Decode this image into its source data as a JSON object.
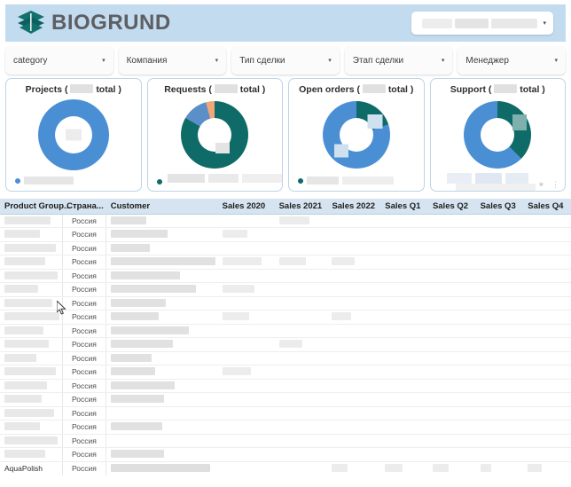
{
  "header": {
    "brand": "BIOGRUND",
    "logo_icon": "hexagon-leaf-logo",
    "band_color": "#c3dbef",
    "brand_text_color": "#5d5f63",
    "logo_color": "#10706c",
    "selector": {
      "name": "header-selector",
      "value": "",
      "caret": "▾"
    }
  },
  "filters": [
    {
      "label": "category",
      "caret": "▾"
    },
    {
      "label": "Компания",
      "caret": "▾"
    },
    {
      "label": "Тип сделки",
      "caret": "▾"
    },
    {
      "label": "Этап сделки",
      "caret": "▾"
    },
    {
      "label": "Менеджер",
      "caret": "▾"
    }
  ],
  "cards": [
    {
      "title_prefix": "Projects (",
      "title_suffix": "total )",
      "donut_colors": [
        "#4a8fd4"
      ],
      "legend_dot": "#4a8fd4"
    },
    {
      "title_prefix": "Requests (",
      "title_suffix": "total )",
      "donut_colors": [
        "#0f6b68",
        "#5a8fc8",
        "#f0a878"
      ],
      "legend_dot": "#0f6b68"
    },
    {
      "title_prefix": "Open orders (",
      "title_suffix": "total )",
      "donut_colors": [
        "#4a8fd4",
        "#0f6b68"
      ],
      "legend_dot": "#0f6b68"
    },
    {
      "title_prefix": "Support (",
      "title_suffix": "total )",
      "donut_colors": [
        "#4a8fd4",
        "#0f6b68"
      ],
      "legend_dot": "#4a8fd4"
    }
  ],
  "card_icons": {
    "pin": "✶",
    "menu": "⋮"
  },
  "table": {
    "columns": [
      "Product Group...",
      "Страна...",
      "Customer",
      "Sales 2020",
      "Sales 2021",
      "Sales 2022",
      "Sales Q1",
      "Sales Q2",
      "Sales Q3",
      "Sales Q4"
    ],
    "country_value": "Россия",
    "rows": [
      {
        "product": "",
        "country": "Россия",
        "customer": ""
      },
      {
        "product": "",
        "country": "Россия",
        "customer": ""
      },
      {
        "product": "",
        "country": "Россия",
        "customer": ""
      },
      {
        "product": "",
        "country": "Россия",
        "customer": ""
      },
      {
        "product": "",
        "country": "Россия",
        "customer": ""
      },
      {
        "product": "",
        "country": "Россия",
        "customer": ""
      },
      {
        "product": "",
        "country": "Россия",
        "customer": ""
      },
      {
        "product": "",
        "country": "Россия",
        "customer": ""
      },
      {
        "product": "",
        "country": "Россия",
        "customer": ""
      },
      {
        "product": "",
        "country": "Россия",
        "customer": ""
      },
      {
        "product": "",
        "country": "Россия",
        "customer": ""
      },
      {
        "product": "",
        "country": "Россия",
        "customer": ""
      },
      {
        "product": "",
        "country": "Россия",
        "customer": ""
      },
      {
        "product": "",
        "country": "Россия",
        "customer": ""
      },
      {
        "product": "",
        "country": "Россия",
        "customer": ""
      },
      {
        "product": "",
        "country": "Россия",
        "customer": ""
      },
      {
        "product": "",
        "country": "Россия",
        "customer": ""
      },
      {
        "product": "",
        "country": "Россия",
        "customer": ""
      },
      {
        "product": "AquaPolish",
        "country": "Россия",
        "customer": ""
      }
    ]
  },
  "colors": {
    "accent_blue": "#4a8fd4",
    "accent_teal": "#0f6b68",
    "accent_orange": "#f0a878",
    "header_band": "#c3dbef",
    "table_header": "#d6e4f1",
    "page_bg": "#f2f2f2"
  }
}
